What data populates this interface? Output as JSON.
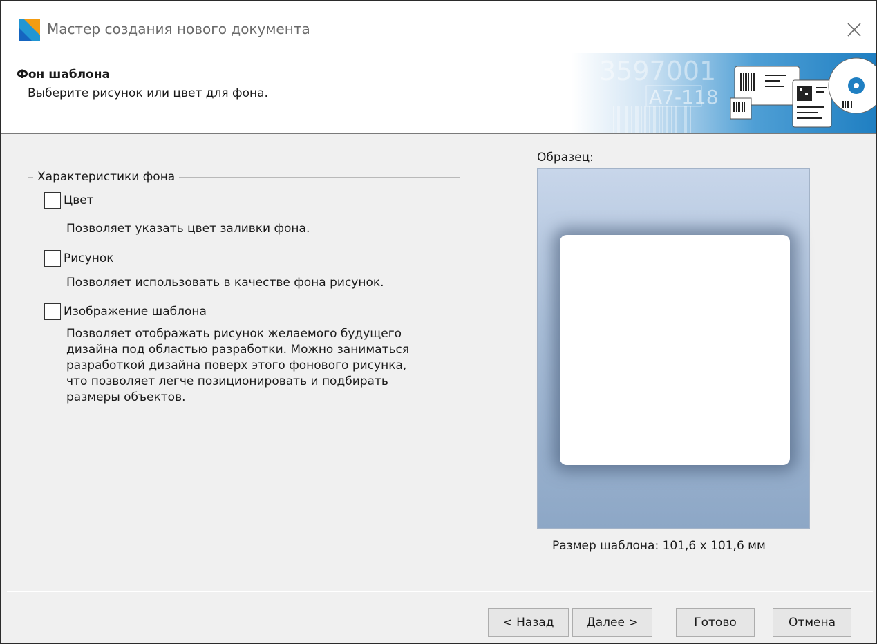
{
  "window": {
    "title": "Мастер создания нового документа",
    "close_icon": "close-icon"
  },
  "header": {
    "title": "Фон шаблона",
    "subtitle": "Выберите рисунок или цвет для фона.",
    "banner_texts": [
      "3597001",
      "A7-118"
    ]
  },
  "group": {
    "legend": "Характеристики фона",
    "options": [
      {
        "label": "Цвет",
        "checked": false,
        "description": [
          "Позволяет указать цвет заливки фона."
        ]
      },
      {
        "label": "Рисунок",
        "checked": false,
        "description": [
          "Позволяет использовать в качестве фона рисунок."
        ]
      },
      {
        "label": "Изображение шаблона",
        "checked": false,
        "description": [
          "Позволяет отображать рисунок желаемого будущего",
          "дизайна под областью разработки. Можно заниматься",
          "разработкой дизайна поверх этого фонового рисунка,",
          "что позволяет легче позиционировать и подбирать",
          "размеры объектов."
        ]
      }
    ]
  },
  "preview": {
    "title": "Образец:",
    "size_text": "Размер шаблона:  101,6 x 101,6 мм"
  },
  "buttons": {
    "back": "< Назад",
    "next": "Далее >",
    "finish": "Готово",
    "cancel": "Отмена"
  },
  "colors": {
    "preview_top": "#c8d6ea",
    "preview_bottom": "#8da7c6",
    "logo_blue": "#1e88e5",
    "logo_orange": "#f5a623"
  }
}
